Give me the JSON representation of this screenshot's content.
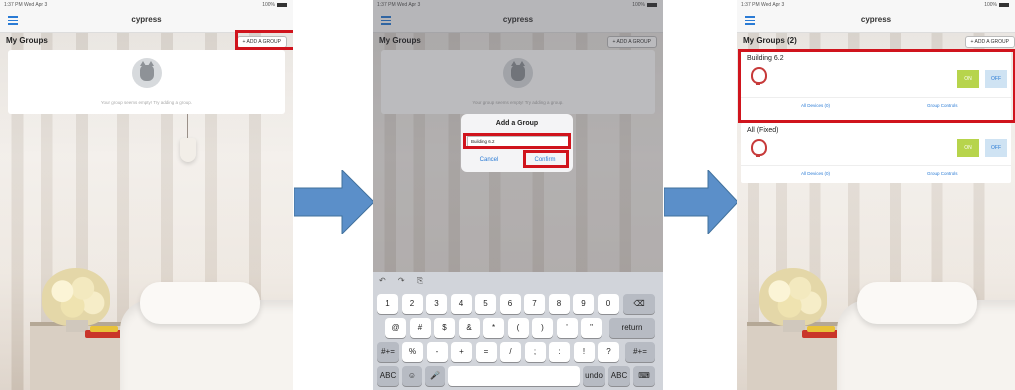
{
  "status_bar": {
    "time": "1:37 PM  Wed Apr 3",
    "battery": "100%"
  },
  "app_title": "cypress",
  "screen1": {
    "groups_title": "My Groups",
    "add_group_button": "+ ADD A GROUP",
    "empty_message": "Your group seems empty! Try adding a group."
  },
  "screen2": {
    "groups_title": "My Groups",
    "add_group_button": "+ ADD A GROUP",
    "empty_message": "Your group seems empty! Try adding a group.",
    "dialog": {
      "title": "Add a Group",
      "input_value": "Building 6.2",
      "cancel": "Cancel",
      "confirm": "Confirm"
    },
    "keyboard": {
      "row1": [
        "1",
        "2",
        "3",
        "4",
        "5",
        "6",
        "7",
        "8",
        "9",
        "0"
      ],
      "row2": [
        "@",
        "#",
        "$",
        "&",
        "*",
        "(",
        ")",
        "'",
        "\""
      ],
      "row3": [
        "%",
        "-",
        "+",
        "=",
        "/",
        ";",
        ":",
        "!",
        "?"
      ],
      "return": "return",
      "shift": "#+=",
      "abc": "ABC",
      "undo": "undo"
    }
  },
  "screen3": {
    "groups_title": "My Groups (2)",
    "add_group_button": "+ ADD A GROUP",
    "groups": [
      {
        "name": "Building 6.2",
        "on": "ON",
        "off": "OFF",
        "all_devices": "All Devices (0)",
        "controls": "Group Controls"
      },
      {
        "name": "All (Fixed)",
        "on": "ON",
        "off": "OFF",
        "all_devices": "All Devices (0)",
        "controls": "Group Controls"
      }
    ]
  },
  "colors": {
    "accent": "#2a7bd5",
    "highlight": "#d0141d",
    "arrow": "#5b8fc9",
    "on_button": "#b7d44c",
    "bulb": "#c73a3a"
  }
}
